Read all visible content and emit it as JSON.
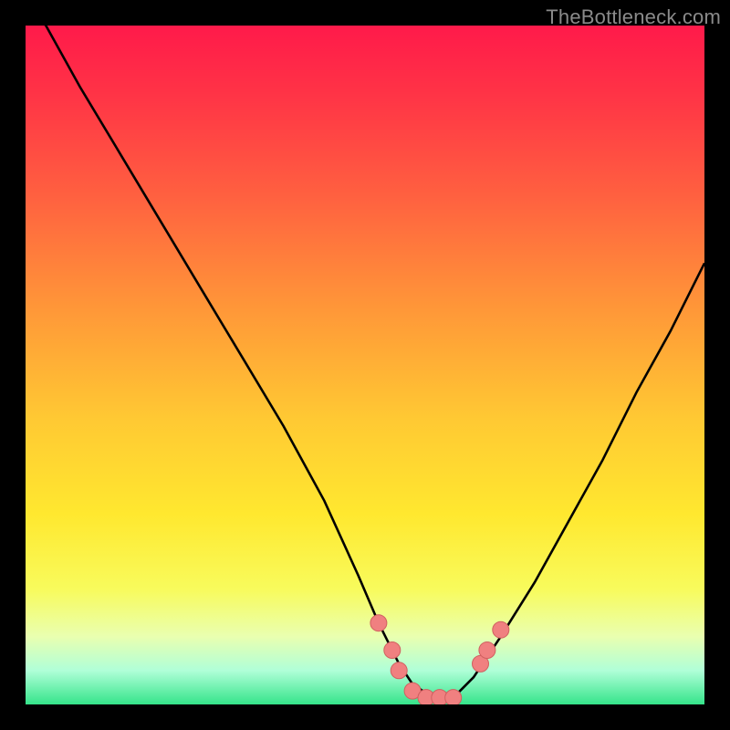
{
  "watermark": "TheBottleneck.com",
  "chart_data": {
    "type": "line",
    "title": "",
    "xlabel": "",
    "ylabel": "",
    "xlim": [
      0,
      100
    ],
    "ylim": [
      0,
      100
    ],
    "series": [
      {
        "name": "bottleneck-curve",
        "x": [
          0,
          3,
          8,
          14,
          20,
          26,
          32,
          38,
          44,
          49,
          52,
          55,
          57,
          60,
          63,
          64,
          66,
          70,
          75,
          80,
          85,
          90,
          95,
          100
        ],
        "values": [
          103,
          100,
          91,
          81,
          71,
          61,
          51,
          41,
          30,
          19,
          12,
          6,
          3,
          1,
          1,
          2,
          4,
          10,
          18,
          27,
          36,
          46,
          55,
          65
        ]
      }
    ],
    "markers": [
      {
        "name": "marker-left-arm-1",
        "x": 52,
        "y": 12
      },
      {
        "name": "marker-left-arm-2",
        "x": 54,
        "y": 8
      },
      {
        "name": "marker-left-arm-3",
        "x": 55,
        "y": 5
      },
      {
        "name": "marker-bottom-1",
        "x": 57,
        "y": 2
      },
      {
        "name": "marker-bottom-2",
        "x": 59,
        "y": 1
      },
      {
        "name": "marker-bottom-3",
        "x": 61,
        "y": 1
      },
      {
        "name": "marker-bottom-4",
        "x": 63,
        "y": 1
      },
      {
        "name": "marker-right-arm-1",
        "x": 67,
        "y": 6
      },
      {
        "name": "marker-right-arm-2",
        "x": 68,
        "y": 8
      },
      {
        "name": "marker-right-arm-3",
        "x": 70,
        "y": 11
      }
    ],
    "colors": {
      "curve": "#000000",
      "marker_fill": "#f08080",
      "marker_stroke": "#d06060"
    }
  }
}
